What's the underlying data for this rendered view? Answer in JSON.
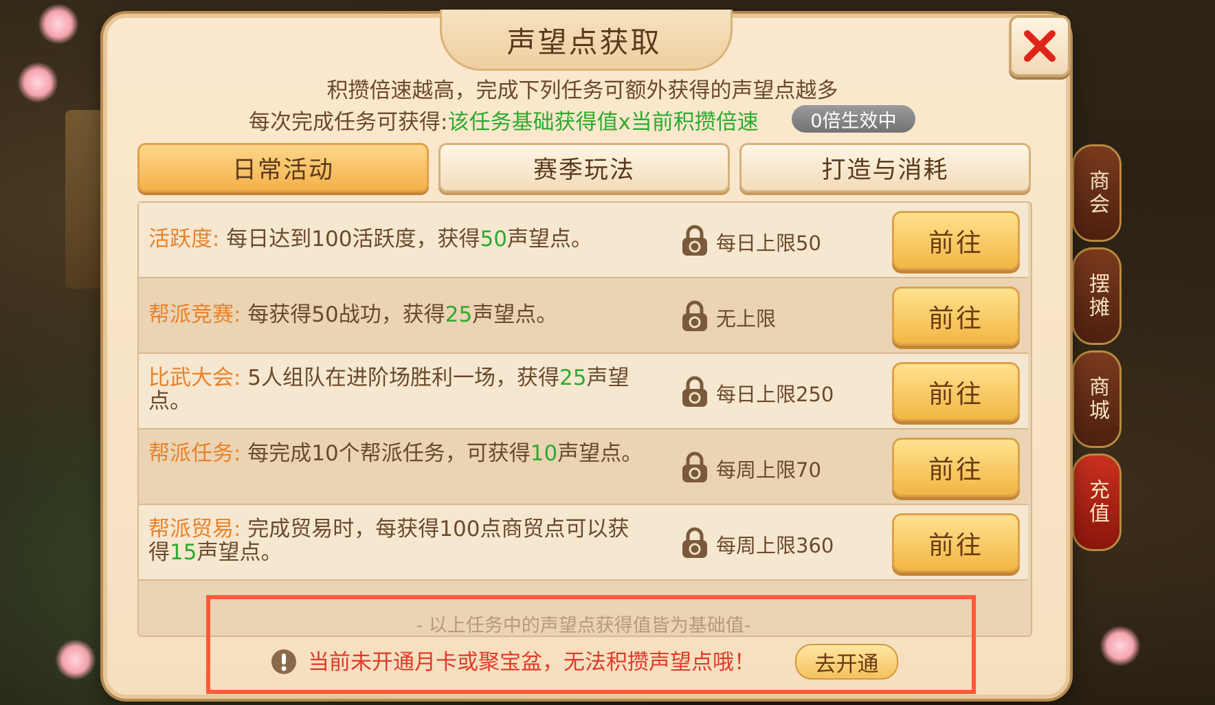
{
  "dialog": {
    "title": "声望点获取",
    "desc_line1": "积攒倍速越高，完成下列任务可额外获得的声望点越多",
    "desc_line2_prefix": "每次完成任务可获得:",
    "desc_line2_formula": "该任务基础获得值x当前积攒倍速",
    "multiplier_badge": "0倍生效中",
    "close_icon": "close-icon"
  },
  "tabs": [
    {
      "label": "日常活动",
      "active": true
    },
    {
      "label": "赛季玩法",
      "active": false
    },
    {
      "label": "打造与消耗",
      "active": false
    }
  ],
  "tasks": [
    {
      "name": "活跃度:",
      "desc_a": " 每日达到100活跃度，获得",
      "num": "50",
      "desc_b": "声望点。",
      "limit": "每日上限50",
      "button": "前往"
    },
    {
      "name": "帮派竞赛:",
      "desc_a": " 每获得50战功，获得",
      "num": "25",
      "desc_b": "声望点。",
      "limit": "无上限",
      "button": "前往"
    },
    {
      "name": "比武大会:",
      "desc_a": " 5人组队在进阶场胜利一场，获得",
      "num": "25",
      "desc_b": "声望点。",
      "limit": "每日上限250",
      "button": "前往"
    },
    {
      "name": "帮派任务:",
      "desc_a": " 每完成10个帮派任务，可获得",
      "num": "10",
      "desc_b": "声望点。",
      "limit": "每周上限70",
      "button": "前往"
    },
    {
      "name": "帮派贸易:",
      "desc_a": " 完成贸易时，每获得100点商贸点可以获得",
      "num": "15",
      "desc_b": "声望点。",
      "limit": "每周上限360",
      "button": "前往"
    }
  ],
  "footer": {
    "note": "- 以上任务中的声望点获得值皆为基础值-",
    "warning": "当前未开通月卡或聚宝盆，无法积攒声望点哦！",
    "open_button": "去开通"
  },
  "side_menu": [
    "商会",
    "摆摊",
    "商城",
    "充值"
  ],
  "colors": {
    "accent_orange": "#e8822a",
    "value_green": "#2eaa2e",
    "warning_red": "#e03a28",
    "highlight_box": "#ff5a3a"
  }
}
